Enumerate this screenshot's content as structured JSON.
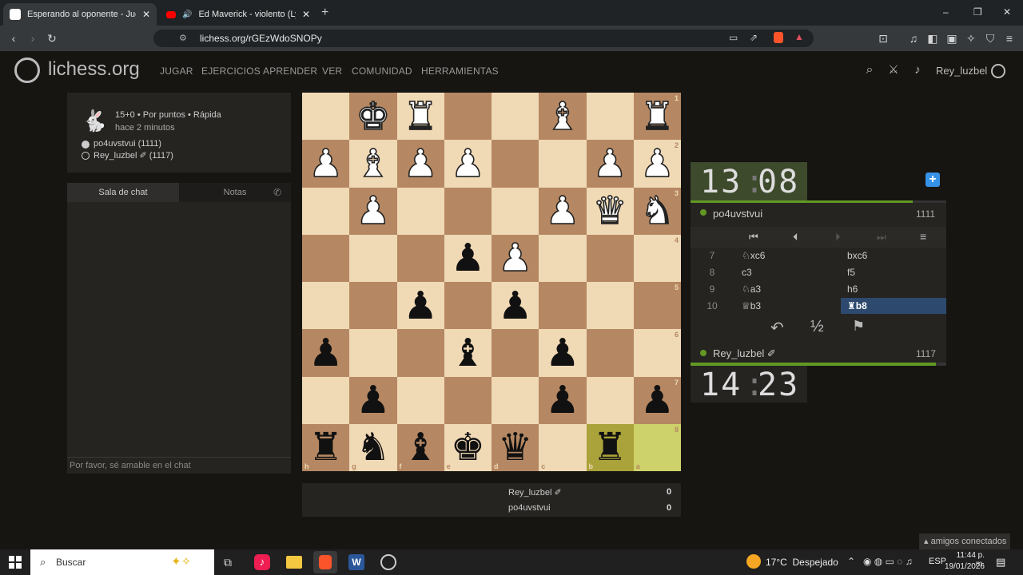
{
  "browser": {
    "tabs": [
      {
        "title": "Esperando al oponente - Jugar p",
        "active": true
      },
      {
        "title": "Ed Maverick - violento (Lyric Vide",
        "active": false
      }
    ],
    "url": "lichess.org/rGEzWdoSNOPy",
    "new_tab": "+",
    "window_controls": [
      "–",
      "❐",
      "✕"
    ]
  },
  "site": {
    "logo": "lichess.org",
    "nav": [
      "JUGAR",
      "EJERCICIOS",
      "APRENDER",
      "VER",
      "COMUNIDAD",
      "HERRAMIENTAS"
    ],
    "user": "Rey_luzbel"
  },
  "game_info": {
    "mode": "15+0 • Por puntos • Rápida",
    "time_ago": "hace 2 minutos",
    "players": [
      {
        "name": "po4uvstvui (1111)",
        "color": "white"
      },
      {
        "name": "Rey_luzbel ✐ (1117)",
        "color": "black"
      }
    ]
  },
  "chat": {
    "tabs": [
      "Sala de chat",
      "Notas"
    ],
    "placeholder": "Por favor, sé amable en el chat"
  },
  "board": {
    "orientation": "black",
    "rank_labels": [
      "1",
      "2",
      "3",
      "4",
      "5",
      "6",
      "7",
      "8"
    ],
    "file_labels": [
      "h",
      "g",
      "f",
      "e",
      "d",
      "c",
      "b",
      "a"
    ],
    "rows": [
      [
        "",
        "wK",
        "wR",
        "",
        "",
        "wB",
        "",
        "wR"
      ],
      [
        "wP",
        "wB",
        "wP",
        "wP",
        "",
        "",
        "wP",
        "wP"
      ],
      [
        "",
        "wP",
        "",
        "",
        "",
        "wP",
        "wQ",
        "wN"
      ],
      [
        "",
        "",
        "",
        "bP",
        "wP",
        "",
        "",
        ""
      ],
      [
        "",
        "",
        "bP",
        "",
        "bP",
        "",
        "",
        ""
      ],
      [
        "bP",
        "",
        "",
        "bB",
        "",
        "bP",
        "",
        ""
      ],
      [
        "",
        "bP",
        "",
        "",
        "",
        "bP",
        "",
        "bP"
      ],
      [
        "bR",
        "bN",
        "bB",
        "bK",
        "bQ",
        "",
        "bR",
        ""
      ]
    ],
    "highlight": [
      [
        7,
        6
      ],
      [
        7,
        7
      ]
    ]
  },
  "score": [
    {
      "name": "Rey_luzbel ✐",
      "score": "0"
    },
    {
      "name": "po4uvstvui",
      "score": "0"
    }
  ],
  "clock_top": {
    "min": "13",
    "sec": "08",
    "progress": 0.87
  },
  "clock_bottom": {
    "min": "14",
    "sec": "23",
    "progress": 0.96
  },
  "opponent": {
    "name": "po4uvstvui",
    "rating": "1111"
  },
  "me": {
    "name": "Rey_luzbel ✐",
    "rating": "1117"
  },
  "moves": [
    {
      "n": "7",
      "w": "♘xc6",
      "b": "bxc6"
    },
    {
      "n": "8",
      "w": "c3",
      "b": "f5"
    },
    {
      "n": "9",
      "w": "♘a3",
      "b": "h6"
    },
    {
      "n": "10",
      "w": "♕b3",
      "b": "♜b8"
    }
  ],
  "controls": {
    "draw": "½"
  },
  "friends": "amigos conectados",
  "taskbar": {
    "search": "Buscar",
    "weather": "17°C  Despejado",
    "lang": "ESP",
    "time": "11:44 p. m.",
    "date": "19/01/2026"
  },
  "colors": {
    "board_light": "#f0d9b5",
    "board_dark": "#b58863",
    "highlight": "#cdd26a",
    "clock_active": "#3d4a2b",
    "accent_green": "#629924"
  }
}
